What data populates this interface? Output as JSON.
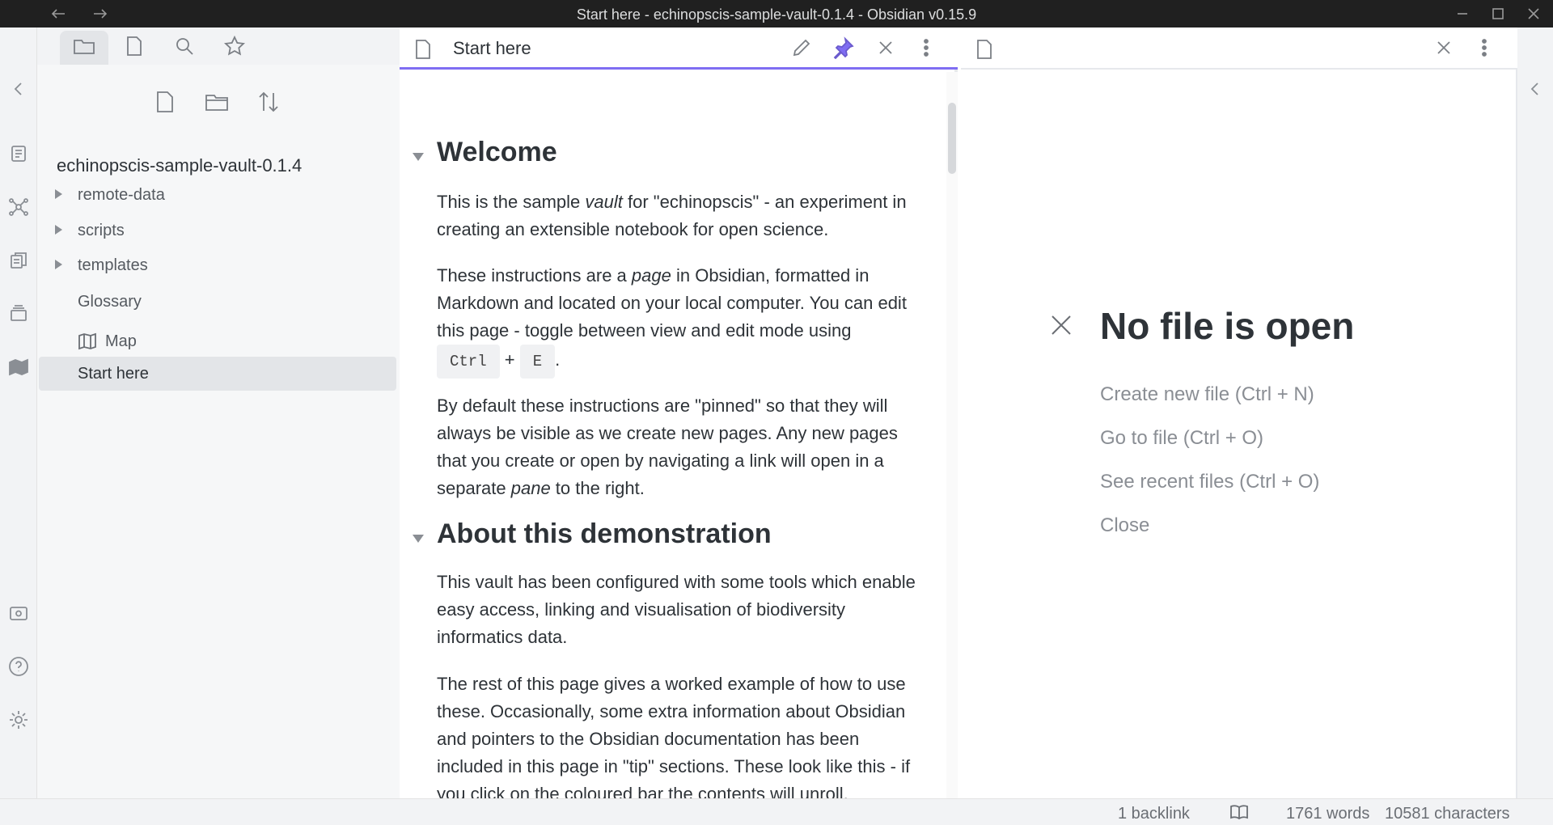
{
  "window": {
    "title": "Start here - echinopscis-sample-vault-0.1.4 - Obsidian v0.15.9",
    "back_icon": "arrow-left-icon",
    "forward_icon": "arrow-right-icon"
  },
  "ribbon": {
    "icons": [
      "collapse-left-icon",
      "switcher-icon",
      "graph-view-icon",
      "templates-icon",
      "slides-icon",
      "map-icon",
      "vault-icon",
      "help-icon",
      "settings-icon"
    ]
  },
  "sidebar": {
    "tabs": [
      "files-icon",
      "file-icon",
      "search-icon",
      "star-icon"
    ],
    "vault_name": "echinopscis-sample-vault-0.1.4",
    "folders": [
      {
        "label": "remote-data"
      },
      {
        "label": "scripts"
      },
      {
        "label": "templates"
      }
    ],
    "files": [
      {
        "label": "Glossary"
      },
      {
        "label": "Map"
      },
      {
        "label": "Start here"
      }
    ]
  },
  "left_pane": {
    "title": "Start here",
    "heading1": "Welcome",
    "p1_a": "This is the sample ",
    "p1_b": "vault",
    "p1_c": " for \"echinopscis\" - an experiment in creating an extensible notebook for open science.",
    "p2_a": "These instructions are a ",
    "p2_b": "page",
    "p2_c": " in Obsidian, formatted in Markdown and located on your local computer. You can edit this page - toggle between view and edit mode using",
    "kbd1": "Ctrl",
    "plus": "+",
    "kbd2": "E",
    "period": ".",
    "p3_a": "By default these instructions are \"pinned\" so that they will always be visible as we create new pages. Any new pages that you create or open by navigating a link will open in a separate ",
    "p3_b": "pane",
    "p3_c": " to the right.",
    "heading2": "About this demonstration",
    "p4": "This vault has been configured with some tools which enable easy access, linking and visualisation of biodiversity informatics data.",
    "p5": "The rest of this page gives a worked example of how to use these. Occasionally, some extra information about Obsidian and pointers to the Obsidian documentation has been included in this page in \"tip\" sections. These look like this - if you click on the coloured bar the contents will unroll."
  },
  "right_pane": {
    "empty_title": "No file is open",
    "actions": [
      "Create new file (Ctrl + N)",
      "Go to file (Ctrl + O)",
      "See recent files (Ctrl + O)",
      "Close"
    ]
  },
  "status": {
    "backlinks": "1 backlink",
    "words": "1761 words",
    "characters": "10581 characters"
  },
  "colors": {
    "accent": "#7f6df2",
    "titlebar": "#202020"
  }
}
